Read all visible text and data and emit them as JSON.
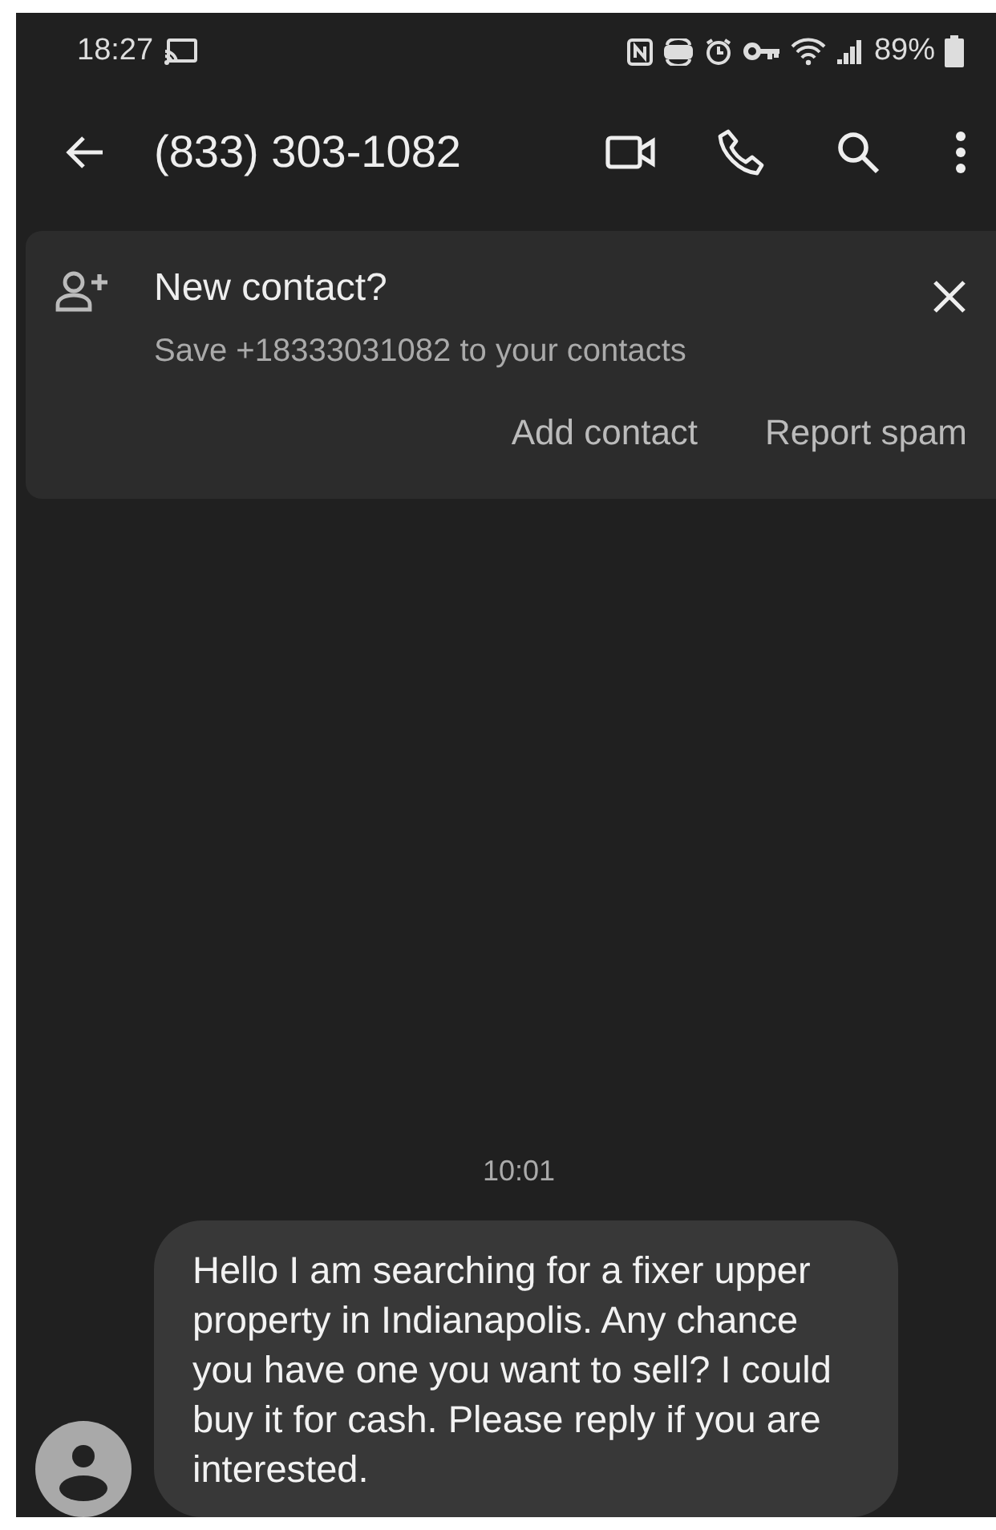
{
  "status_bar": {
    "time": "18:27",
    "battery": "89%"
  },
  "toolbar": {
    "title": "(833) 303-1082"
  },
  "banner": {
    "title": "New contact?",
    "subtitle": "Save +18333031082 to your contacts",
    "actions": [
      "Add contact",
      "Report spam"
    ]
  },
  "conversation": {
    "timestamp": "10:01",
    "messages": [
      {
        "text": "Hello I am searching for a fixer upper property in Indianapolis. Any chance you have one you want to sell? I could buy it for cash. Please reply if you are interested."
      }
    ]
  }
}
